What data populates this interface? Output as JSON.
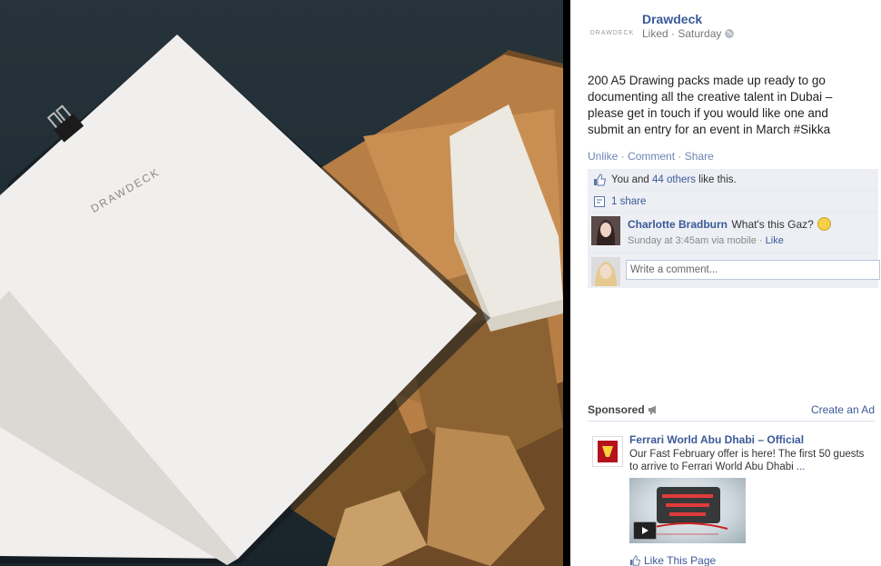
{
  "photo": {
    "notebook_brand": "DRAWDECK"
  },
  "post": {
    "page_name": "Drawdeck",
    "logo_text": "DRAWDECK",
    "meta": "Liked · Saturday",
    "body": "200 A5 Drawing packs made up ready to go documenting all the creative talent in Dubai – please get in touch if you would like one and submit an entry for an event in March #Sikka",
    "actions": {
      "unlike": "Unlike",
      "comment": "Comment",
      "share": "Share"
    }
  },
  "ufi": {
    "likes_prefix": "You and ",
    "likes_link": "44 others",
    "likes_suffix": " like this.",
    "shares": "1 share",
    "comment": {
      "author": "Charlotte Bradburn",
      "text": "What's this Gaz?",
      "meta_prefix": "Sunday at 3:45am via mobile · ",
      "like_link": "Like"
    },
    "write_placeholder": "Write a comment..."
  },
  "sponsored": {
    "title": "Sponsored",
    "create_ad": "Create an Ad",
    "ad": {
      "title": "Ferrari World Abu Dhabi – Official",
      "body": "Our Fast February offer is here! The first 50 guests to arrive to Ferrari World Abu Dhabi ",
      "more": "...",
      "like_page": "Like This Page"
    }
  },
  "colors": {
    "link_blue": "#3b5998",
    "action_blue": "#6d84b4",
    "ufi_bg": "#edeff4"
  }
}
